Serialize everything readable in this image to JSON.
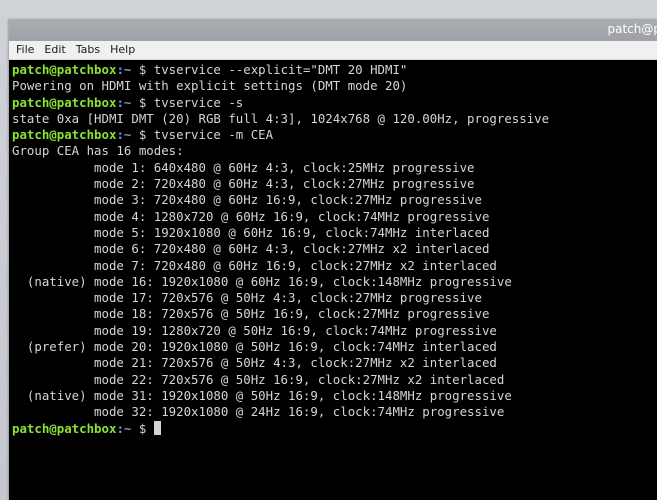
{
  "window": {
    "title": "patch@p"
  },
  "menubar": {
    "items": [
      "File",
      "Edit",
      "Tabs",
      "Help"
    ]
  },
  "terminal": {
    "prompt_user": "patch@patchbox",
    "prompt_path": ":~",
    "prompt_dollar": " $ ",
    "lines": [
      {
        "type": "cmd",
        "text": "tvservice --explicit=\"DMT 20 HDMI\""
      },
      {
        "type": "out",
        "text": "Powering on HDMI with explicit settings (DMT mode 20)"
      },
      {
        "type": "cmd",
        "text": "tvservice -s"
      },
      {
        "type": "out",
        "text": "state 0xa [HDMI DMT (20) RGB full 4:3], 1024x768 @ 120.00Hz, progressive"
      },
      {
        "type": "cmd",
        "text": "tvservice -m CEA"
      },
      {
        "type": "out",
        "text": "Group CEA has 16 modes:"
      },
      {
        "type": "out",
        "text": "           mode 1: 640x480 @ 60Hz 4:3, clock:25MHz progressive"
      },
      {
        "type": "out",
        "text": "           mode 2: 720x480 @ 60Hz 4:3, clock:27MHz progressive"
      },
      {
        "type": "out",
        "text": "           mode 3: 720x480 @ 60Hz 16:9, clock:27MHz progressive"
      },
      {
        "type": "out",
        "text": "           mode 4: 1280x720 @ 60Hz 16:9, clock:74MHz progressive"
      },
      {
        "type": "out",
        "text": "           mode 5: 1920x1080 @ 60Hz 16:9, clock:74MHz interlaced"
      },
      {
        "type": "out",
        "text": "           mode 6: 720x480 @ 60Hz 4:3, clock:27MHz x2 interlaced"
      },
      {
        "type": "out",
        "text": "           mode 7: 720x480 @ 60Hz 16:9, clock:27MHz x2 interlaced"
      },
      {
        "type": "out",
        "text": "  (native) mode 16: 1920x1080 @ 60Hz 16:9, clock:148MHz progressive"
      },
      {
        "type": "out",
        "text": "           mode 17: 720x576 @ 50Hz 4:3, clock:27MHz progressive"
      },
      {
        "type": "out",
        "text": "           mode 18: 720x576 @ 50Hz 16:9, clock:27MHz progressive"
      },
      {
        "type": "out",
        "text": "           mode 19: 1280x720 @ 50Hz 16:9, clock:74MHz progressive"
      },
      {
        "type": "out",
        "text": "  (prefer) mode 20: 1920x1080 @ 50Hz 16:9, clock:74MHz interlaced"
      },
      {
        "type": "out",
        "text": "           mode 21: 720x576 @ 50Hz 4:3, clock:27MHz x2 interlaced"
      },
      {
        "type": "out",
        "text": "           mode 22: 720x576 @ 50Hz 16:9, clock:27MHz x2 interlaced"
      },
      {
        "type": "out",
        "text": "  (native) mode 31: 1920x1080 @ 50Hz 16:9, clock:148MHz progressive"
      },
      {
        "type": "out",
        "text": "           mode 32: 1920x1080 @ 24Hz 16:9, clock:74MHz progressive"
      },
      {
        "type": "prompt",
        "text": ""
      }
    ]
  },
  "colors": {
    "prompt_user": "#8ae234",
    "prompt_path": "#729fcf",
    "text": "#d3d7cf",
    "background": "#000000"
  }
}
